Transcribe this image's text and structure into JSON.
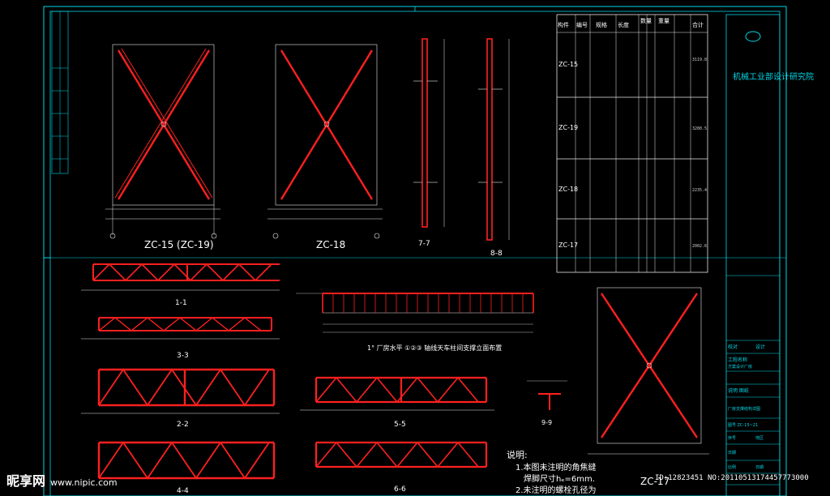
{
  "drawing": {
    "views": {
      "zc15": "ZC-15 (ZC-19)",
      "zc18": "ZC-18",
      "zc17": "ZC-17",
      "s77": "7-7",
      "s88": "8-8",
      "s11": "1-1",
      "s33": "3-3",
      "s22": "2-2",
      "s44": "4-4",
      "s55": "5-5",
      "s66": "6-6",
      "s99": "9-9",
      "elev": "1° 厂房水平 ①②③ 轴线天车柱间支撑立面布置"
    },
    "notes": {
      "title": "说明:",
      "line1": "1.本图未注明的角焦缝",
      "line1b": "焊脚尺寸hₑ=6mm.",
      "line2": "2.未注明的螺栓孔径为"
    },
    "table": {
      "headers": [
        "构件",
        "编号",
        "规格",
        "长度",
        "数量",
        "重量",
        "合计"
      ],
      "groups": [
        "ZC-15",
        "ZC-19",
        "ZC-18",
        "ZC-17"
      ],
      "totals": [
        "3119.8",
        "3280.5",
        "2235.4",
        "2002.6"
      ]
    },
    "title_block": {
      "institute": "机械工业部设计研究院",
      "row1": "校对",
      "row2": "设计",
      "row3": "工程名称",
      "row4": "方案设计厂房",
      "row5": "说明 图纸",
      "row6": "厂房支撑结构详图",
      "row7": "图号 ZC-15~21",
      "row8": "序号",
      "row9": "地区",
      "row10": "日期",
      "row11": "比例",
      "row12": "日期"
    }
  },
  "watermarks": {
    "brand": "昵享网",
    "url": "www.nipic.com",
    "id": "ID:12823451 NO:20110513174457773000"
  },
  "colors": {
    "frame": "#00d8e8",
    "member": "#ff2020",
    "dimension": "#e8e8e8",
    "background": "#000000"
  }
}
